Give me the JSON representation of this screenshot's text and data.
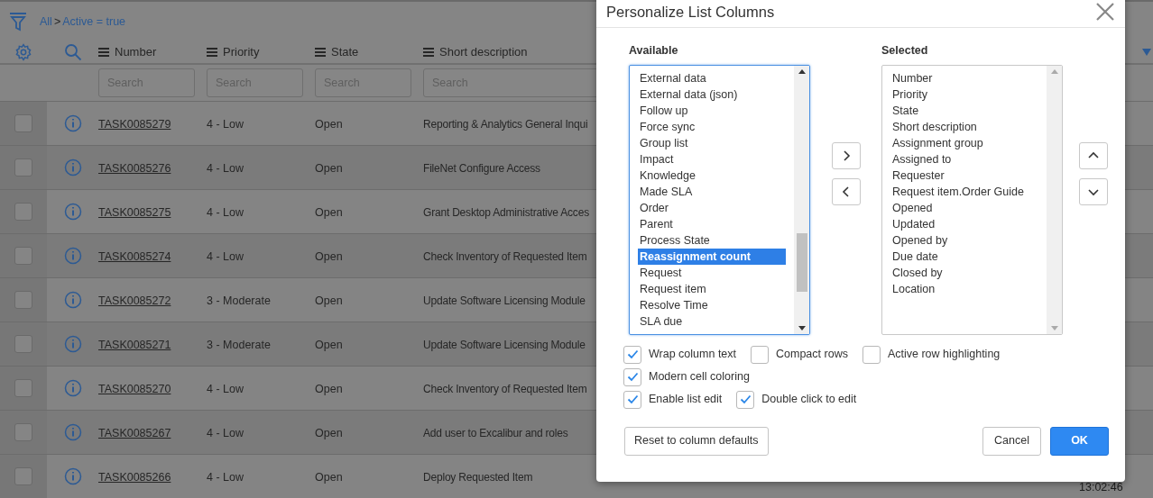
{
  "list": {
    "breadcrumb": {
      "root": "All",
      "separator": ">",
      "condition": "Active = true"
    },
    "columns": [
      "Number",
      "Priority",
      "State",
      "Short description"
    ],
    "search_placeholders": [
      "Search",
      "Search",
      "Search",
      "Search"
    ],
    "rows": [
      {
        "checked": false,
        "number": "TASK0085279",
        "priority": "4 - Low",
        "state": "Open",
        "description": "Reporting & Analytics General Inqui"
      },
      {
        "checked": false,
        "number": "TASK0085276",
        "priority": "4 - Low",
        "state": "Open",
        "description": "FileNet Configure Access"
      },
      {
        "checked": false,
        "number": "TASK0085275",
        "priority": "4 - Low",
        "state": "Open",
        "description": "Grant Desktop Administrative Acces"
      },
      {
        "checked": false,
        "number": "TASK0085274",
        "priority": "4 - Low",
        "state": "Open",
        "description": "Check Inventory of Requested Item"
      },
      {
        "checked": false,
        "number": "TASK0085272",
        "priority": "3 - Moderate",
        "state": "Open",
        "description": "Update Software Licensing Module"
      },
      {
        "checked": false,
        "number": "TASK0085271",
        "priority": "3 - Moderate",
        "state": "Open",
        "description": "Update Software Licensing Module"
      },
      {
        "checked": false,
        "number": "TASK0085270",
        "priority": "4 - Low",
        "state": "Open",
        "description": "Check Inventory of Requested Item"
      },
      {
        "checked": false,
        "number": "TASK0085267",
        "priority": "4 - Low",
        "state": "Open",
        "description": "Add user to Excalibur and roles"
      },
      {
        "checked": false,
        "number": "TASK0085266",
        "priority": "4 - Low",
        "state": "Open",
        "description": "Deploy Requested Item"
      }
    ],
    "timestamp": "13:02:46"
  },
  "dialog": {
    "title": "Personalize List Columns",
    "available": {
      "label": "Available",
      "items": [
        {
          "label": "External data",
          "selected": false
        },
        {
          "label": "External data (json)",
          "selected": false
        },
        {
          "label": "Follow up",
          "selected": false
        },
        {
          "label": "Force sync",
          "selected": false
        },
        {
          "label": "Group list",
          "selected": false
        },
        {
          "label": "Impact",
          "selected": false
        },
        {
          "label": "Knowledge",
          "selected": false
        },
        {
          "label": "Made SLA",
          "selected": false
        },
        {
          "label": "Order",
          "selected": false
        },
        {
          "label": "Parent",
          "selected": false
        },
        {
          "label": "Process State",
          "selected": false
        },
        {
          "label": "Reassignment count",
          "selected": true
        },
        {
          "label": "Request",
          "selected": false
        },
        {
          "label": "Request item",
          "selected": false
        },
        {
          "label": "Resolve Time",
          "selected": false
        },
        {
          "label": "SLA due",
          "selected": false
        }
      ]
    },
    "selected": {
      "label": "Selected",
      "items": [
        {
          "label": "Number",
          "selected": false
        },
        {
          "label": "Priority",
          "selected": false
        },
        {
          "label": "State",
          "selected": false
        },
        {
          "label": "Short description",
          "selected": false
        },
        {
          "label": "Assignment group",
          "selected": false
        },
        {
          "label": "Assigned to",
          "selected": false
        },
        {
          "label": "Requester",
          "selected": false
        },
        {
          "label": "Request item.Order Guide",
          "selected": false
        },
        {
          "label": "Opened",
          "selected": false
        },
        {
          "label": "Updated",
          "selected": false
        },
        {
          "label": "Opened by",
          "selected": false
        },
        {
          "label": "Due date",
          "selected": false
        },
        {
          "label": "Closed by",
          "selected": false
        },
        {
          "label": "Location",
          "selected": false
        }
      ]
    },
    "options": [
      [
        {
          "label": "Wrap column text",
          "checked": true
        },
        {
          "label": "Compact rows",
          "checked": false
        },
        {
          "label": "Active row highlighting",
          "checked": false
        }
      ],
      [
        {
          "label": "Modern cell coloring",
          "checked": true
        }
      ],
      [
        {
          "label": "Enable list edit",
          "checked": true
        },
        {
          "label": "Double click to edit",
          "checked": true
        }
      ]
    ],
    "buttons": {
      "reset": "Reset to column defaults",
      "cancel": "Cancel",
      "ok": "OK"
    }
  }
}
